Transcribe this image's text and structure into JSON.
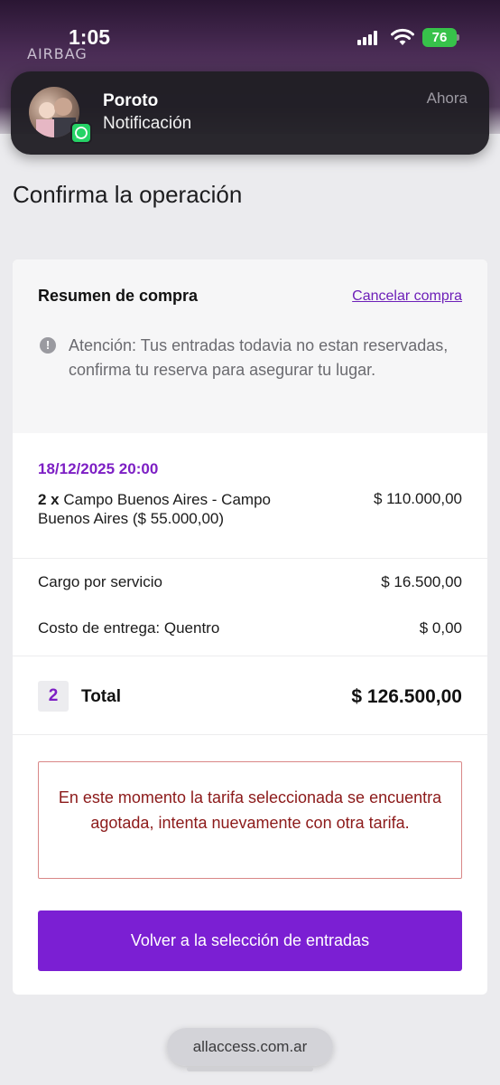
{
  "status_bar": {
    "time": "1:05",
    "battery": "76",
    "signal_icon": "cellular-signal-icon",
    "wifi_icon": "wifi-icon"
  },
  "banner": {
    "brand_text": "AIRBAG"
  },
  "notification": {
    "sender": "Poroto",
    "body": "Notificación",
    "time": "Ahora",
    "app_icon": "whatsapp-icon"
  },
  "page": {
    "title": "Confirma la operación"
  },
  "summary": {
    "title": "Resumen de compra",
    "cancel_label": "Cancelar compra",
    "attention": "Atención: Tus entradas todavia no estan reservadas, confirma tu reserva para asegurar tu lugar.",
    "event_date": "18/12/2025 20:00",
    "ticket_qty": "2 x",
    "ticket_name": "Campo Buenos Aires - Campo Buenos Aires ($ 55.000,00)",
    "ticket_amount": "$ 110.000,00",
    "service_label": "Cargo por servicio",
    "service_amount": "$ 16.500,00",
    "delivery_label": "Costo de entrega: Quentro",
    "delivery_amount": "$ 0,00",
    "total_qty": "2",
    "total_label": "Total",
    "total_amount": "$ 126.500,00"
  },
  "error": {
    "message": "En este momento la tarifa seleccionada se encuentra agotada, intenta nuevamente con otra tarifa."
  },
  "actions": {
    "back_label": "Volver a la selección de entradas"
  },
  "browser": {
    "url": "allaccess.com.ar"
  },
  "colors": {
    "accent": "#7b1fd3",
    "error": "#8c1a1a",
    "error_border": "#d98787"
  }
}
